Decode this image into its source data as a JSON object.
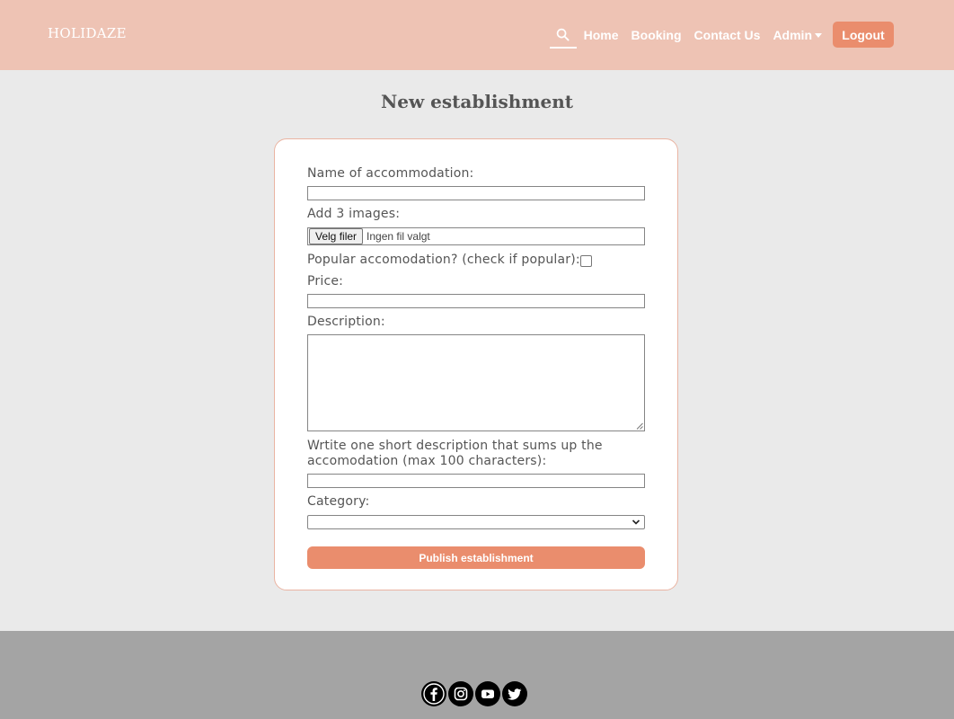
{
  "header": {
    "brand": "HOLIDAZE",
    "nav": {
      "home": "Home",
      "booking": "Booking",
      "contact": "Contact Us",
      "admin": "Admin",
      "logout": "Logout"
    }
  },
  "page": {
    "title": "New establishment"
  },
  "form": {
    "name_label": "Name of accommodation:",
    "name_value": "",
    "images_label": "Add 3 images:",
    "file_button": "Velg filer",
    "file_status": "Ingen fil valgt",
    "popular_label": "Popular accomodation? (check if popular):",
    "popular_checked": false,
    "price_label": "Price:",
    "price_value": "",
    "description_label": "Description:",
    "description_value": "",
    "short_label_line1": "Wrtite one short description that sums up the",
    "short_label_line2": "accomodation (max 100 characters):",
    "short_value": "",
    "category_label": "Category:",
    "category_value": "",
    "submit": "Publish establishment"
  },
  "footer": {
    "social": [
      "facebook-icon",
      "instagram-icon",
      "youtube-icon",
      "twitter-icon"
    ]
  },
  "colors": {
    "header_bg": "#eec3b4",
    "accent": "#ea8d6d",
    "page_bg": "#eaeaea",
    "footer_bg": "#a4a4a4"
  }
}
